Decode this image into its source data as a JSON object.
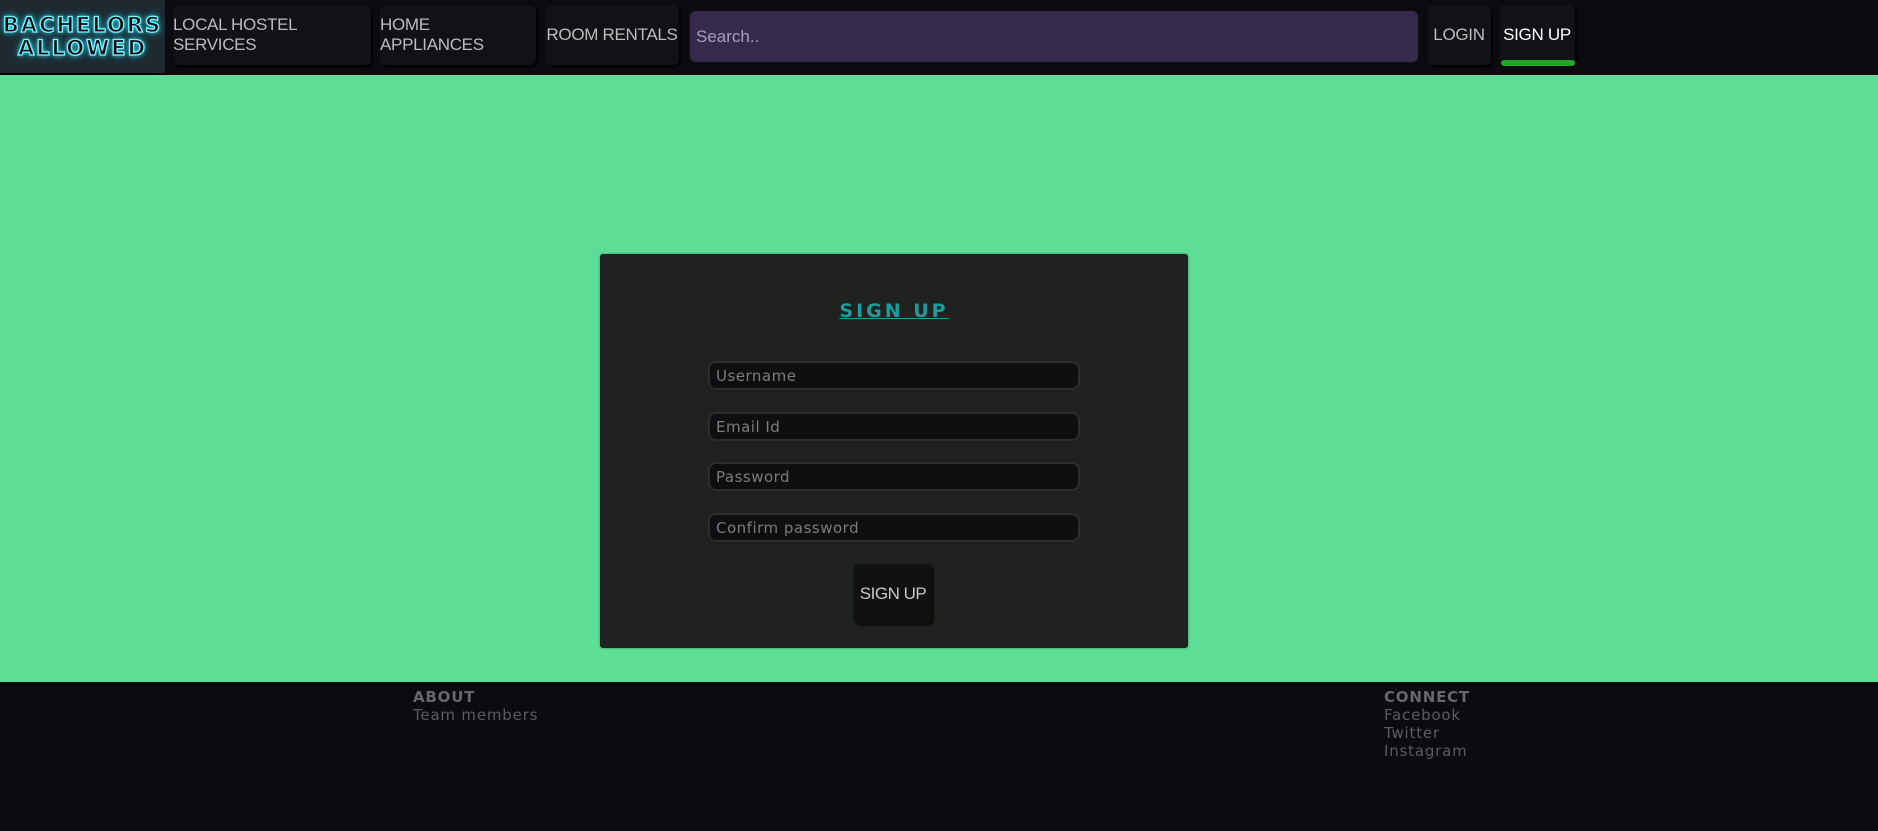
{
  "logo": {
    "line1": "BACHELORS",
    "line2": "ALLOWED"
  },
  "nav": {
    "local_hostel": "LOCAL HOSTEL SERVICES",
    "home_appliances": "HOME APPLIANCES",
    "room_rentals": "ROOM RENTALS",
    "search_placeholder": "Search..",
    "login": "LOGIN",
    "signup": "SIGN UP",
    "active_item": "SIGN UP",
    "active_color": "#23a52d"
  },
  "form": {
    "title": "SIGN UP",
    "username_placeholder": "Username",
    "email_placeholder": "Email Id",
    "password_placeholder": "Password",
    "confirm_placeholder": "Confirm password",
    "submit_label": "SIGN UP"
  },
  "footer": {
    "about": {
      "heading": "ABOUT",
      "links": [
        "Team members"
      ]
    },
    "connect": {
      "heading": "CONNECT",
      "links": [
        "Facebook",
        "Twitter",
        "Instagram"
      ]
    }
  },
  "colors": {
    "background": "#5ddd95",
    "card": "#1f221f",
    "title_accent": "#1a9d9e",
    "search_bg": "#352a4e",
    "logo_glow": "#7ff3ff"
  }
}
